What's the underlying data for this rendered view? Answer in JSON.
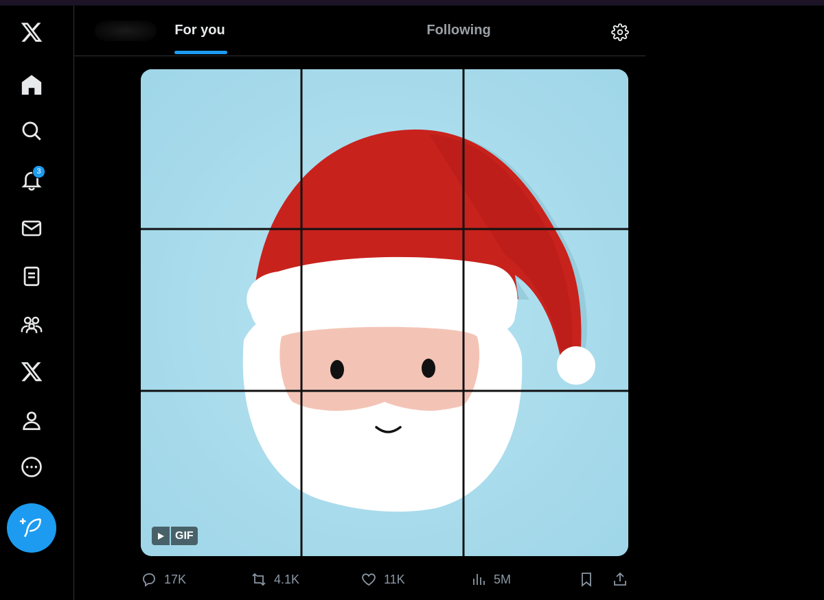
{
  "tabs": [
    {
      "label": "For you",
      "active": true
    },
    {
      "label": "Following",
      "active": false
    }
  ],
  "sidebar": {
    "items": [
      {
        "name": "x-logo-icon"
      },
      {
        "name": "home-icon"
      },
      {
        "name": "search-icon"
      },
      {
        "name": "notifications-icon",
        "badge": "3"
      },
      {
        "name": "messages-icon"
      },
      {
        "name": "lists-icon"
      },
      {
        "name": "communities-icon"
      },
      {
        "name": "premium-x-icon"
      },
      {
        "name": "profile-icon"
      },
      {
        "name": "more-icon"
      }
    ],
    "compose_icon": "compose-feather-icon"
  },
  "post": {
    "media_label": "GIF",
    "replies": "17K",
    "reposts": "4.1K",
    "likes": "11K",
    "views": "5M"
  },
  "colors": {
    "accent": "#1d9bf0",
    "background": "#000000",
    "sky": "#a9dced",
    "hat": "#c8221d"
  }
}
